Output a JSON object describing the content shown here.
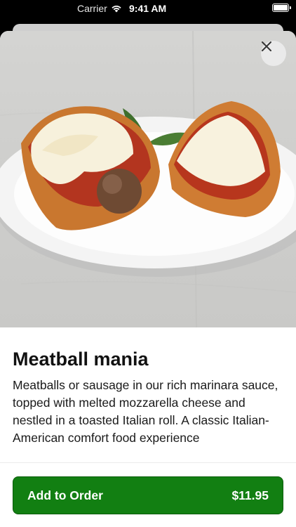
{
  "status_bar": {
    "carrier": "Carrier",
    "time": "9:41 AM",
    "wifi_icon": "wifi-icon",
    "battery_icon": "battery-icon"
  },
  "item": {
    "image_alt_icon": "meatball-sub-photo",
    "title": "Meatball mania",
    "description": "Meatballs or sausage in our rich marinara sauce, topped with melted mozzarella cheese and nestled in a toasted Italian roll. A classic Italian-American comfort food experience"
  },
  "actions": {
    "close_icon": "close-icon",
    "add_label": "Add to Order",
    "price": "$11.95"
  },
  "colors": {
    "accent": "#127f12",
    "background": "#ffffff"
  }
}
